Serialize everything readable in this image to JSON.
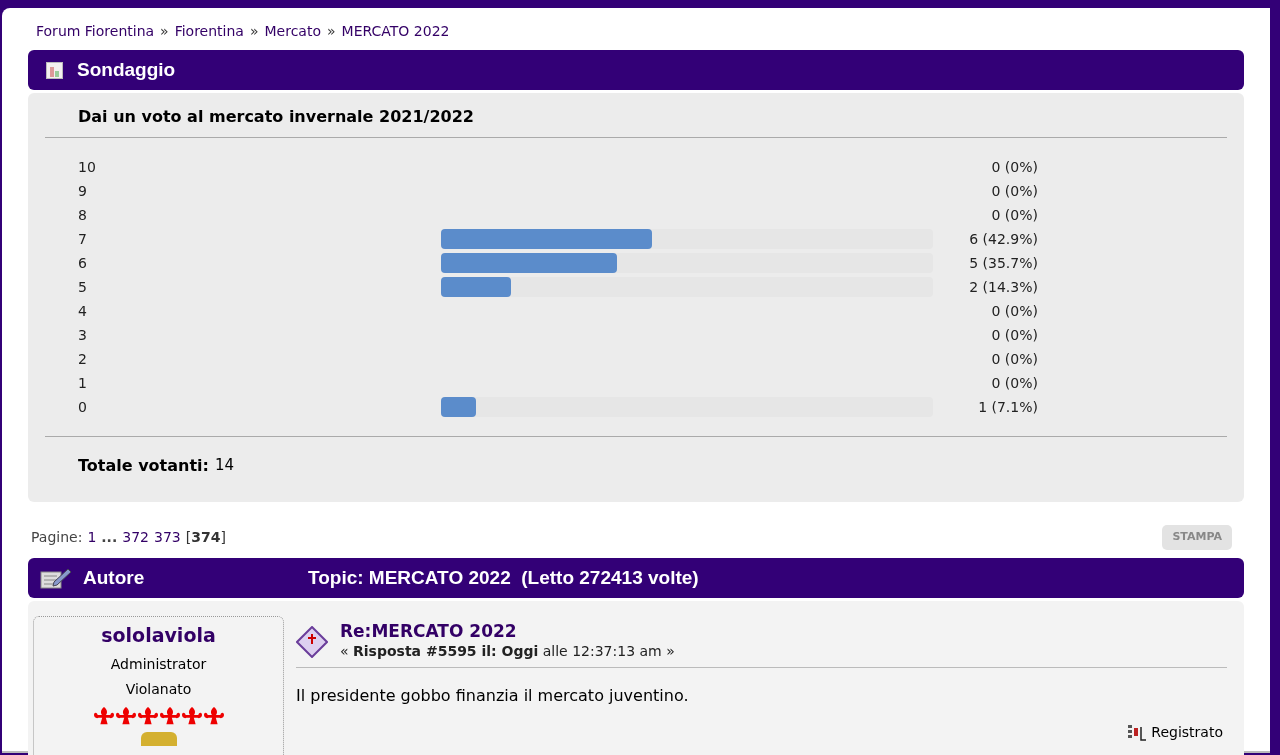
{
  "breadcrumb": {
    "separator": "»",
    "items": [
      "Forum Fiorentina",
      "Fiorentina",
      "Mercato",
      "MERCATO 2022"
    ]
  },
  "poll": {
    "header": "Sondaggio",
    "question": "Dai un voto al mercato invernale 2021/2022",
    "options": [
      {
        "label": "10",
        "result": "0 (0%)"
      },
      {
        "label": "9",
        "result": "0 (0%)"
      },
      {
        "label": "8",
        "result": "0 (0%)"
      },
      {
        "label": "7",
        "result": "6 (42.9%)",
        "level": 0.429
      },
      {
        "label": "6",
        "result": "5 (35.7%)",
        "level": 0.357
      },
      {
        "label": "5",
        "result": "2 (14.3%)",
        "level": 0.143
      },
      {
        "label": "4",
        "result": "0 (0%)"
      },
      {
        "label": "3",
        "result": "0 (0%)"
      },
      {
        "label": "2",
        "result": "0 (0%)"
      },
      {
        "label": "1",
        "result": "0 (0%)"
      },
      {
        "label": "0",
        "result": "1 (7.1%)",
        "level": 0.071
      }
    ],
    "total_label": "Totale votanti:",
    "total": "14"
  },
  "pagination": {
    "label": "Pagine:",
    "pages": [
      {
        "text": "1",
        "selected": false
      },
      {
        "text": "...",
        "kind": "gap"
      },
      {
        "text": "372",
        "selected": false
      },
      {
        "text": "373",
        "selected": false
      },
      {
        "text": "374",
        "selected": true
      }
    ],
    "current_open": "[",
    "current_close": "]"
  },
  "print_button": "STAMPA",
  "topic_header": {
    "author": "Autore",
    "topic": "Topic: MERCATO 2022  (Letto 272413 volte)"
  },
  "post": {
    "username": "sololaviola",
    "role": "Administrator",
    "group": "Violanato",
    "stars": 6,
    "subject": "Re:MERCATO 2022",
    "meta": "« **Risposta #5595 il: Oggi** alle 12:37:13 am »",
    "body": "Il presidente gobbo finanzia il mercato juventino.",
    "status": "Registrato"
  }
}
